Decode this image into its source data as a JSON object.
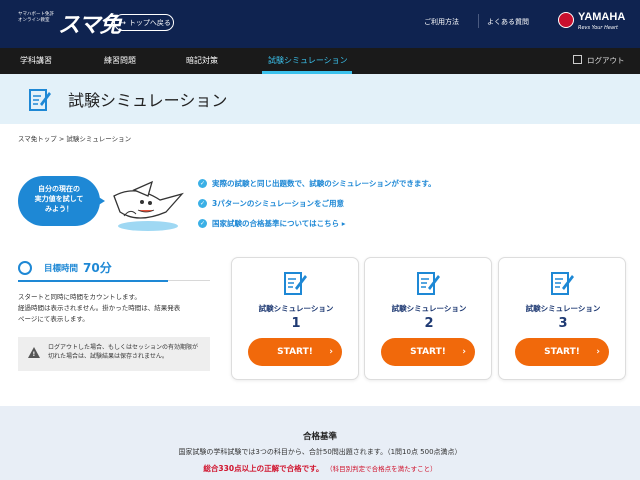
{
  "header": {
    "logo_sub_line1": "ヤマハボート免許",
    "logo_sub_line2": "オンライン教室",
    "logo_main": "スマ免",
    "back_label": "トップへ戻る",
    "usage_label": "ご利用方法",
    "faq_label": "よくある質問",
    "brand": "YAMAHA",
    "brand_tagline": "Revs Your Heart"
  },
  "nav": {
    "items": [
      {
        "label": "学科講習"
      },
      {
        "label": "練習問題"
      },
      {
        "label": "暗記対策"
      },
      {
        "label": "試験シミュレーション"
      }
    ],
    "active_index": 3,
    "logout_label": "ログアウト"
  },
  "page": {
    "title": "試験シミュレーション",
    "breadcrumb": "スマ免トップ > 試験シミュレーション"
  },
  "intro": {
    "bubble_line1": "自分の現在の",
    "bubble_line2": "実力値を試して",
    "bubble_line3": "みよう！",
    "features": [
      "実際の試験と同じ出題数で、試験のシミュレーションができます。",
      "3パターンのシミュレーションをご用意",
      "国家試験の合格基準についてはこちら ▸"
    ]
  },
  "target": {
    "label": "目標時間",
    "value": "70分",
    "desc_line1": "スタートと同時に時間をカウントします。",
    "desc_line2": "経過時間は表示されません。掛かった時間は、結果発表",
    "desc_line3": "ページにて表示します。",
    "warn_line1": "ログアウトした場合、もしくはセッションの有効期限が",
    "warn_line2": "切れた場合は、試験結果は保存されません。"
  },
  "cards": [
    {
      "title": "試験シミュレーション",
      "num": "1",
      "button": "START!"
    },
    {
      "title": "試験シミュレーション",
      "num": "2",
      "button": "START!"
    },
    {
      "title": "試験シミュレーション",
      "num": "3",
      "button": "START!"
    }
  ],
  "pass": {
    "title": "合格基準",
    "line1": "国家試験の学科試験では3つの科目から、合計50問出題されます。（1問10点 500点満点）",
    "highlight": "総合330点以上の正解で合格です。",
    "note": "（科目別判定で合格点を満たすこと）"
  },
  "colors": {
    "header_bg": "#0f2350",
    "nav_bg": "#1a1a1a",
    "accent_blue": "#1e88d5",
    "nav_active": "#3bc1ec",
    "start_orange": "#f1690b",
    "alert_red": "#d0112b"
  }
}
